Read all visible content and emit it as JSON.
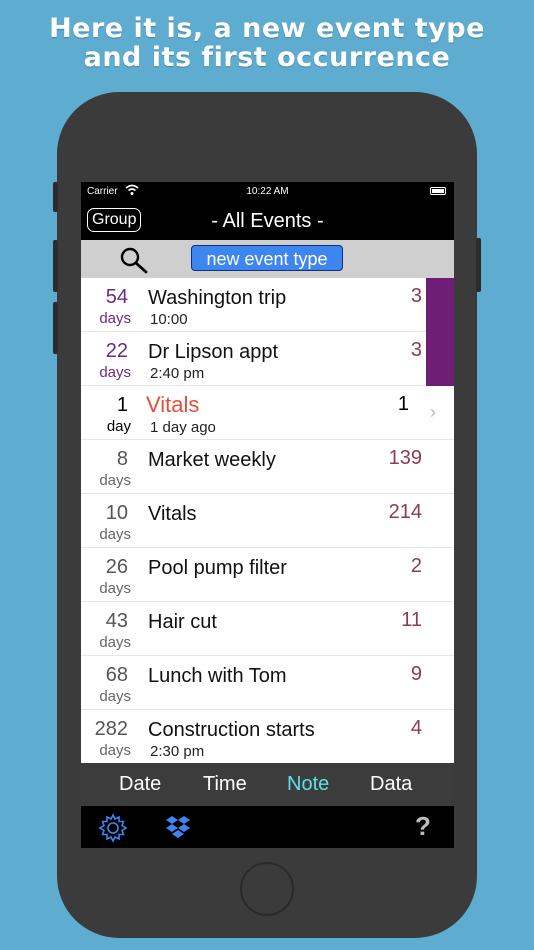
{
  "headline": {
    "line1": "Here it is, a new event type",
    "line2": "and its first occurrence"
  },
  "statusbar": {
    "carrier": "Carrier",
    "time": "10:22 AM",
    "wifi_icon": "wifi-icon",
    "battery_icon": "battery-icon"
  },
  "navbar": {
    "group_label": "Group",
    "title": "- All Events -"
  },
  "search": {
    "icon": "search-icon",
    "new_event_label": "new event type"
  },
  "events": [
    {
      "num": "54",
      "unit": "days",
      "name": "Washington trip",
      "sub": "10:00",
      "count": "3"
    },
    {
      "num": "22",
      "unit": "days",
      "name": "Dr Lipson appt",
      "sub": "2:40 pm",
      "count": "3"
    },
    {
      "num": "1",
      "unit": "day",
      "name": "Vitals",
      "sub": "1 day ago",
      "count": "1"
    },
    {
      "num": "8",
      "unit": "days",
      "name": "Market weekly",
      "sub": "",
      "count": "139"
    },
    {
      "num": "10",
      "unit": "days",
      "name": "Vitals",
      "sub": "",
      "count": "214"
    },
    {
      "num": "26",
      "unit": "days",
      "name": "Pool pump filter",
      "sub": "",
      "count": "2"
    },
    {
      "num": "43",
      "unit": "days",
      "name": "Hair cut",
      "sub": "",
      "count": "11"
    },
    {
      "num": "68",
      "unit": "days",
      "name": "Lunch with Tom",
      "sub": "",
      "count": "9"
    },
    {
      "num": "282",
      "unit": "days",
      "name": "Construction starts",
      "sub": "2:30 pm",
      "count": "4"
    }
  ],
  "tabs": {
    "date": "Date",
    "time": "Time",
    "note": "Note",
    "data": "Data",
    "active": "Note"
  },
  "toolbar": {
    "settings_icon": "gear-icon",
    "dropbox_icon": "dropbox-icon",
    "help_label": "?"
  },
  "colors": {
    "background": "#5eadd1",
    "highlight_text": "#e74c3c",
    "purple_accent": "#6e1e74",
    "active_tab": "#5ee0e8",
    "new_button": "#3d86f0"
  }
}
